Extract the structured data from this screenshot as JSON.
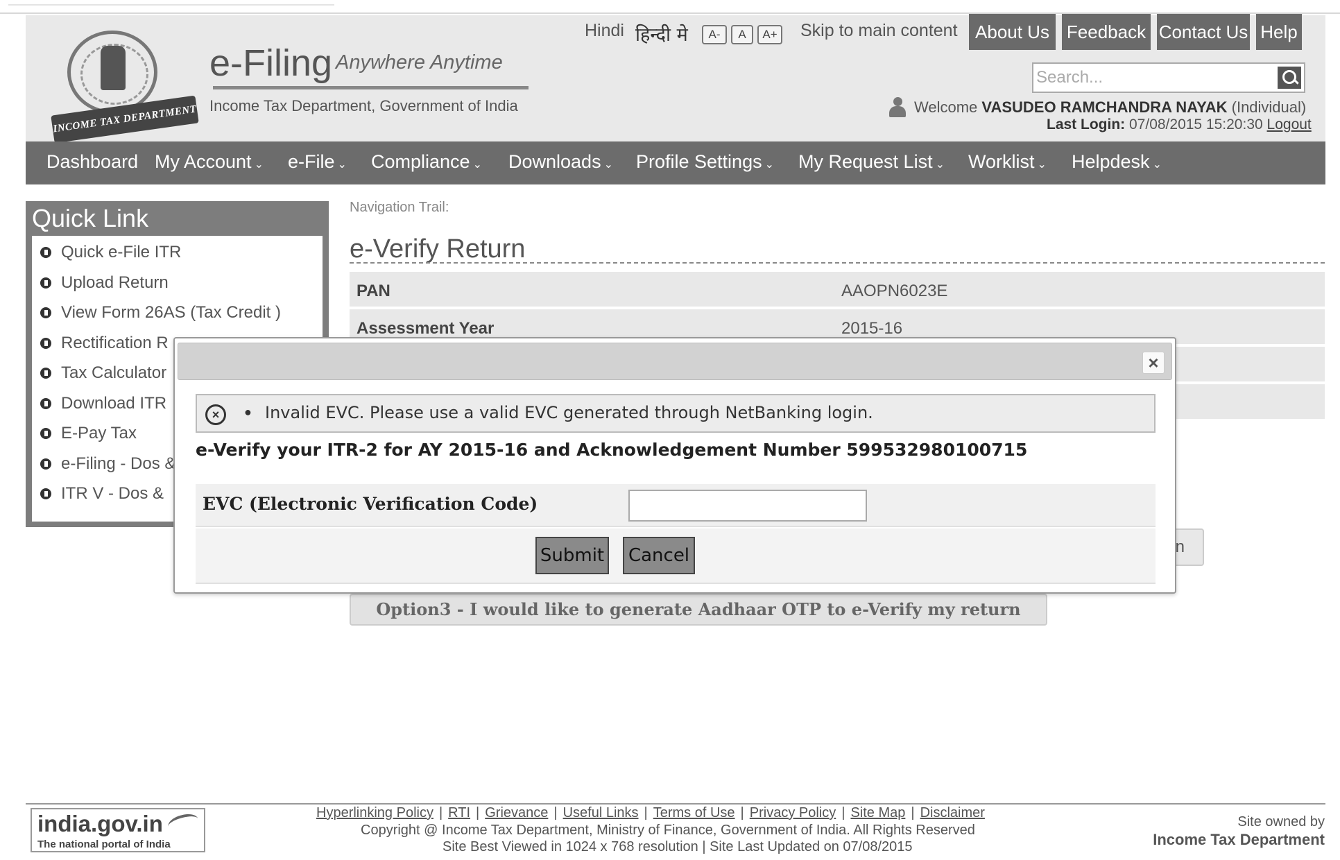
{
  "header": {
    "emblem_text": "INCOME TAX DEPARTMENT",
    "brand_title": "e-Filing",
    "brand_tagline": "Anywhere Anytime",
    "brand_subtitle": "Income Tax Department, Government of India",
    "lang_label": "Hindi",
    "lang_hindi": "हिन्दी मे",
    "font_sizes": [
      "A-",
      "A",
      "A+"
    ],
    "skip_link": "Skip to main content",
    "top_buttons": [
      "About Us",
      "Feedback",
      "Contact Us",
      "Help"
    ],
    "search_placeholder": "Search...",
    "welcome_prefix": "Welcome",
    "user_name": "VASUDEO RAMCHANDRA NAYAK",
    "user_type": "(Individual)",
    "last_login_label": "Last Login:",
    "last_login_value": "07/08/2015 15:20:30",
    "logout_label": "Logout"
  },
  "nav": {
    "items": [
      "Dashboard",
      "My Account",
      "e-File",
      "Compliance",
      "Downloads",
      "Profile Settings",
      "My Request List",
      "Worklist",
      "Helpdesk"
    ]
  },
  "sidebar": {
    "title": "Quick Link",
    "items": [
      "Quick e-File ITR",
      "Upload Return",
      "View Form 26AS (Tax Credit )",
      "Rectification R",
      "Tax Calculator",
      "Download ITR",
      "E-Pay Tax",
      "e-Filing - Dos &",
      "ITR V - Dos &"
    ]
  },
  "main": {
    "navigation_trail": "Navigation Trail:",
    "page_title": "e-Verify Return",
    "rows": [
      {
        "label": "PAN",
        "value": "AAOPN6023E"
      },
      {
        "label": "Assessment Year",
        "value": "2015-16"
      }
    ],
    "option2_fragment": "n",
    "option3_label": "Option3 - I would like to generate Aadhaar OTP to e-Verify my return"
  },
  "modal": {
    "error_message": "Invalid EVC. Please use a valid EVC generated through NetBanking login.",
    "verify_heading": "e-Verify your ITR-2 for AY 2015-16 and Acknowledgement Number 599532980100715",
    "evc_label": "EVC (Electronic Verification Code)",
    "evc_value": "",
    "submit_label": "Submit",
    "cancel_label": "Cancel"
  },
  "footer": {
    "india_title": "india.gov.in",
    "india_subtitle": "The national portal of India",
    "links": [
      "Hyperlinking Policy",
      "RTI",
      "Grievance",
      "Useful Links",
      "Terms of Use",
      "Privacy Policy",
      "Site Map",
      "Disclaimer"
    ],
    "copyright": "Copyright @ Income Tax Department, Ministry of Finance, Government of India. All Rights Reserved",
    "best_viewed": "Site Best Viewed in 1024 x 768 resolution | Site Last Updated on 07/08/2015",
    "owned_line1": "Site owned by",
    "owned_line2": "Income Tax Department"
  }
}
